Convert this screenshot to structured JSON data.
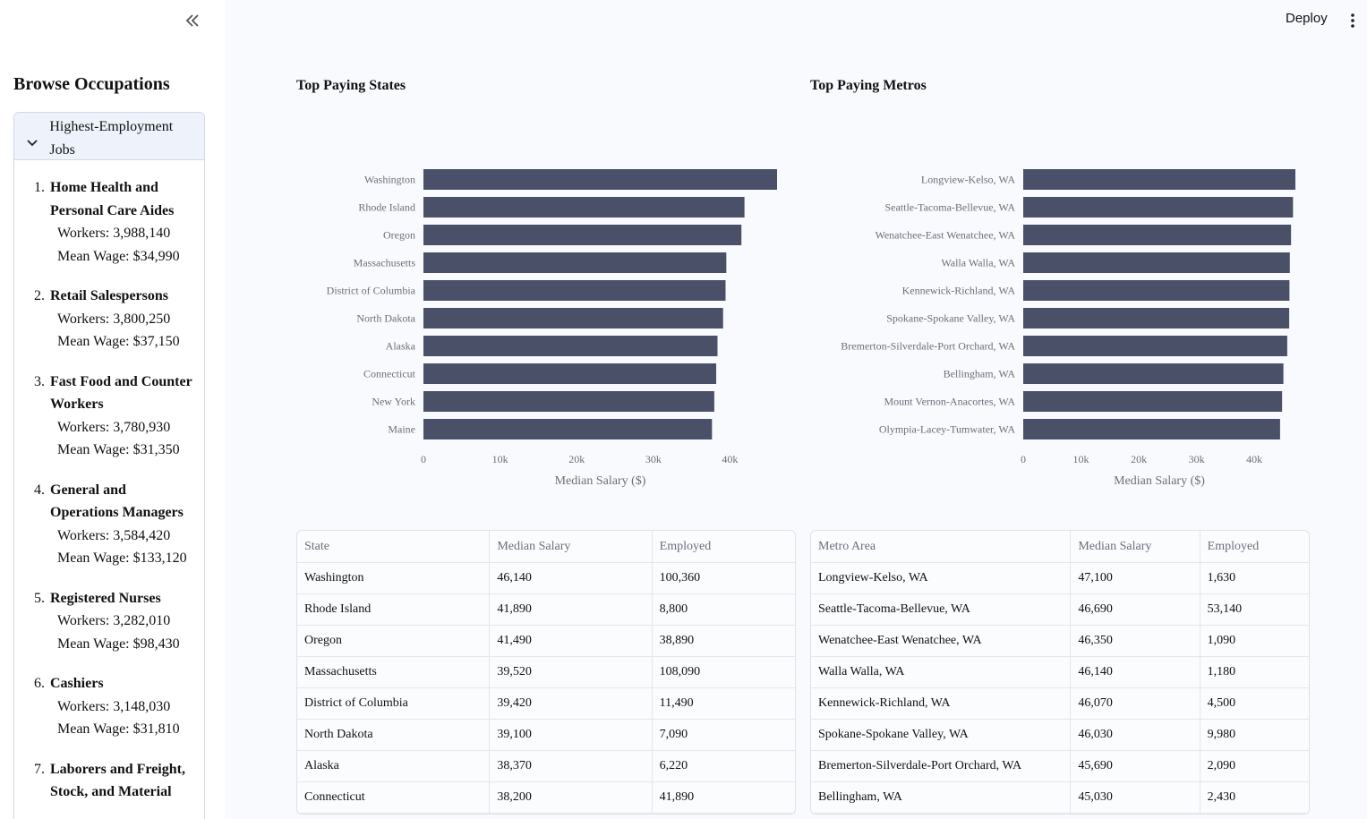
{
  "topbar": {
    "deploy_label": "Deploy",
    "menu_icon": "kebab-icon"
  },
  "sidebar": {
    "collapse_icon": "double-chevron-left-icon",
    "title": "Browse Occupations",
    "expander": {
      "label": "Highest-Employment Jobs",
      "icon": "chevron-down-icon",
      "items": [
        {
          "num": "1.",
          "name": "Home Health and Personal Care Aides",
          "workers": "Workers: 3,988,140",
          "wage": "Mean Wage: $34,990"
        },
        {
          "num": "2.",
          "name": "Retail Salespersons",
          "workers": "Workers: 3,800,250",
          "wage": "Mean Wage: $37,150"
        },
        {
          "num": "3.",
          "name": "Fast Food and Counter Workers",
          "workers": "Workers: 3,780,930",
          "wage": "Mean Wage: $31,350"
        },
        {
          "num": "4.",
          "name": "General and Operations Managers",
          "workers": "Workers: 3,584,420",
          "wage": "Mean Wage: $133,120"
        },
        {
          "num": "5.",
          "name": "Registered Nurses",
          "workers": "Workers: 3,282,010",
          "wage": "Mean Wage: $98,430"
        },
        {
          "num": "6.",
          "name": "Cashiers",
          "workers": "Workers: 3,148,030",
          "wage": "Mean Wage: $31,810"
        },
        {
          "num": "7.",
          "name": "Laborers and Freight, Stock, and Material",
          "workers": "",
          "wage": ""
        }
      ]
    }
  },
  "colors": {
    "bar": "#4a5068",
    "axis_text": "#6b6f7a"
  },
  "chart_data": [
    {
      "type": "bar",
      "orientation": "horizontal",
      "title": "Top Paying States",
      "xlabel": "Median Salary ($)",
      "ylabel": "",
      "xlim": [
        0,
        46140
      ],
      "xticks": [
        0,
        10000,
        20000,
        30000,
        40000
      ],
      "xtick_labels": [
        "0",
        "10k",
        "20k",
        "30k",
        "40k"
      ],
      "categories": [
        "Washington",
        "Rhode Island",
        "Oregon",
        "Massachusetts",
        "District of Columbia",
        "North Dakota",
        "Alaska",
        "Connecticut",
        "New York",
        "Maine"
      ],
      "values": [
        46140,
        41890,
        41490,
        39520,
        39420,
        39100,
        38370,
        38200,
        37950,
        37650
      ]
    },
    {
      "type": "bar",
      "orientation": "horizontal",
      "title": "Top Paying Metros",
      "xlabel": "Median Salary ($)",
      "ylabel": "",
      "xlim": [
        0,
        47100
      ],
      "xticks": [
        0,
        10000,
        20000,
        30000,
        40000
      ],
      "xtick_labels": [
        "0",
        "10k",
        "20k",
        "30k",
        "40k"
      ],
      "categories": [
        "Longview-Kelso, WA",
        "Seattle-Tacoma-Bellevue, WA",
        "Wenatchee-East Wenatchee, WA",
        "Walla Walla, WA",
        "Kennewick-Richland, WA",
        "Spokane-Spokane Valley, WA",
        "Bremerton-Silverdale-Port Orchard, WA",
        "Bellingham, WA",
        "Mount Vernon-Anacortes, WA",
        "Olympia-Lacey-Tumwater, WA"
      ],
      "values": [
        47100,
        46690,
        46350,
        46140,
        46070,
        46030,
        45690,
        45030,
        44800,
        44450
      ]
    }
  ],
  "tables": {
    "states": {
      "headers": [
        "State",
        "Median Salary",
        "Employed"
      ],
      "rows": [
        [
          "Washington",
          "46,140",
          "100,360"
        ],
        [
          "Rhode Island",
          "41,890",
          "8,800"
        ],
        [
          "Oregon",
          "41,490",
          "38,890"
        ],
        [
          "Massachusetts",
          "39,520",
          "108,090"
        ],
        [
          "District of Columbia",
          "39,420",
          "11,490"
        ],
        [
          "North Dakota",
          "39,100",
          "7,090"
        ],
        [
          "Alaska",
          "38,370",
          "6,220"
        ],
        [
          "Connecticut",
          "38,200",
          "41,890"
        ]
      ]
    },
    "metros": {
      "headers": [
        "Metro Area",
        "Median Salary",
        "Employed"
      ],
      "rows": [
        [
          "Longview-Kelso, WA",
          "47,100",
          "1,630"
        ],
        [
          "Seattle-Tacoma-Bellevue, WA",
          "46,690",
          "53,140"
        ],
        [
          "Wenatchee-East Wenatchee, WA",
          "46,350",
          "1,090"
        ],
        [
          "Walla Walla, WA",
          "46,140",
          "1,180"
        ],
        [
          "Kennewick-Richland, WA",
          "46,070",
          "4,500"
        ],
        [
          "Spokane-Spokane Valley, WA",
          "46,030",
          "9,980"
        ],
        [
          "Bremerton-Silverdale-Port Orchard, WA",
          "45,690",
          "2,090"
        ],
        [
          "Bellingham, WA",
          "45,030",
          "2,430"
        ]
      ]
    }
  }
}
